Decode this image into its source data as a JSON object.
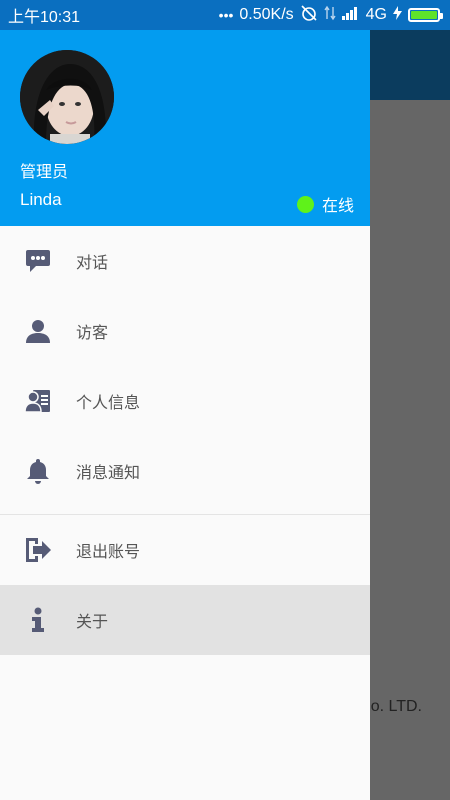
{
  "status_bar": {
    "time": "上午10:31",
    "network_speed": "0.50K/s",
    "network_type": "4G",
    "battery_level": 1.0,
    "icons": [
      "more-dots-icon",
      "alarm-off-icon",
      "data-transfer-icon",
      "signal-icon",
      "charging-icon",
      "battery-icon"
    ]
  },
  "drawer": {
    "header": {
      "role": "管理员",
      "username": "Linda",
      "status_text": "在线",
      "status_color": "#5ff21a",
      "background_color": "#039cf0"
    },
    "menu": [
      {
        "label": "对话",
        "icon": "chat-bubble-icon"
      },
      {
        "label": "访客",
        "icon": "person-icon"
      },
      {
        "label": "个人信息",
        "icon": "profile-card-icon"
      },
      {
        "label": "消息通知",
        "icon": "bell-icon"
      }
    ],
    "menu_secondary": [
      {
        "label": "退出账号",
        "icon": "logout-icon"
      },
      {
        "label": "关于",
        "icon": "info-icon",
        "selected": true
      }
    ]
  },
  "background": {
    "footer_text": "o. LTD.",
    "toolbar_color": "#0b3c5e"
  }
}
